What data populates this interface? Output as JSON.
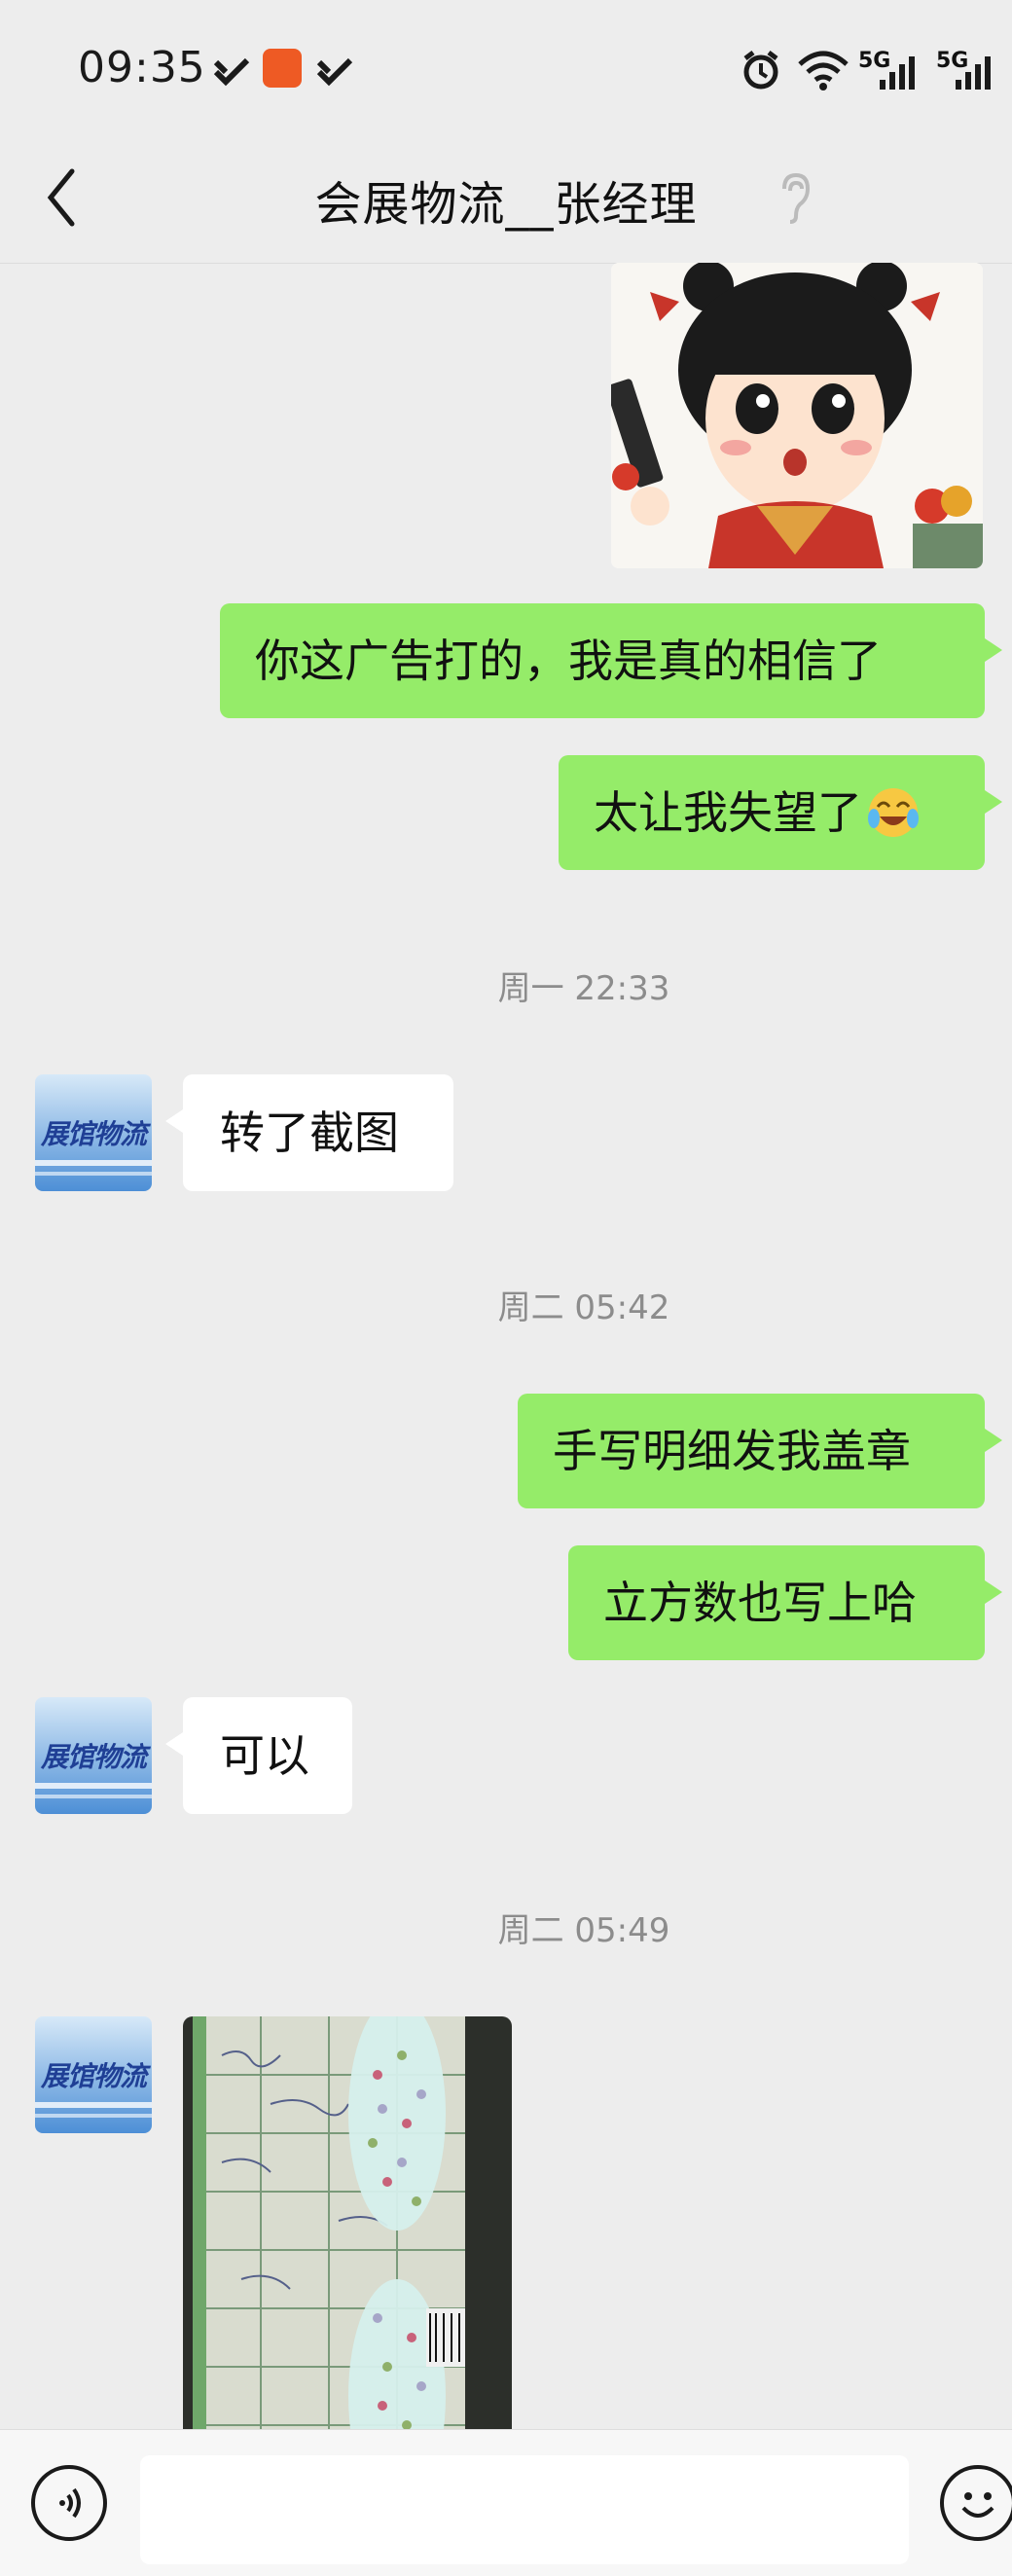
{
  "status_bar": {
    "time": "09:35",
    "signal1": "5G",
    "signal2": "5G"
  },
  "header": {
    "title": "会展物流__张经理"
  },
  "contact": {
    "avatar_text": "展馆物流"
  },
  "messages": [
    {
      "from": "me",
      "type": "sticker"
    },
    {
      "from": "me",
      "type": "text",
      "text": "你这广告打的，我是真的相信了"
    },
    {
      "from": "me",
      "type": "text",
      "text": "太让我失望了"
    },
    {
      "type": "timestamp",
      "text": "周一 22:33"
    },
    {
      "from": "other",
      "type": "text",
      "text": "转了截图"
    },
    {
      "type": "timestamp",
      "text": "周二 05:42"
    },
    {
      "from": "me",
      "type": "text",
      "text": "手写明细发我盖章"
    },
    {
      "from": "me",
      "type": "text",
      "text": "立方数也写上哈"
    },
    {
      "from": "other",
      "type": "text",
      "text": "可以"
    },
    {
      "type": "timestamp",
      "text": "周二 05:49"
    },
    {
      "from": "other",
      "type": "image"
    }
  ],
  "icons": {
    "back": "back-arrow-icon",
    "ear": "earpiece-icon",
    "voice": "voice-input-icon",
    "emoji": "emoji-icon"
  }
}
